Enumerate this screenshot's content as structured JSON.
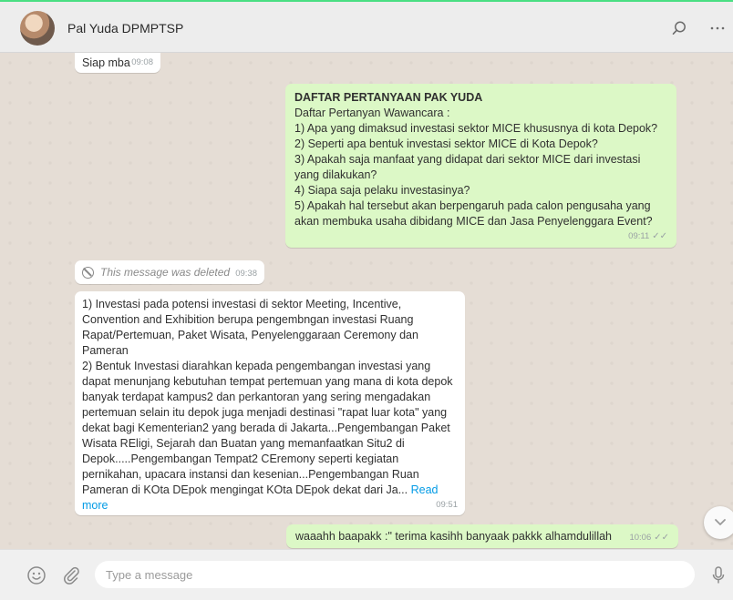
{
  "header": {
    "contact_name": "Pal Yuda DPMPTSP",
    "icons": [
      "avatar",
      "search-icon",
      "more-icon"
    ]
  },
  "messages": [
    {
      "direction": "incoming",
      "text": "Siap mba",
      "time": "09:08"
    },
    {
      "direction": "outgoing",
      "title": "DAFTAR PERTANYAAN PAK YUDA",
      "lines": [
        "Daftar Pertanyan Wawancara :",
        "1) Apa yang dimaksud investasi sektor MICE khususnya di kota Depok?",
        "2) Seperti apa bentuk investasi sektor MICE di Kota Depok?",
        "3) Apakah saja manfaat yang didapat dari sektor MICE dari investasi yang dilakukan?",
        "4) Siapa saja pelaku investasinya?",
        "5) Apakah hal tersebut akan berpengaruh pada calon pengusaha yang akan membuka usaha dibidang MICE dan Jasa Penyelenggara Event?"
      ],
      "time": "09:11",
      "status": "read"
    },
    {
      "direction": "incoming",
      "deleted_text": "This message was deleted",
      "time": "09:38"
    },
    {
      "direction": "incoming",
      "lines": [
        "1) Investasi pada potensi investasi di sektor Meeting, Incentive, Convention and Exhibition berupa pengembngan investasi Ruang Rapat/Pertemuan, Paket Wisata, Penyelenggaraan Ceremony dan Pameran",
        "2) Bentuk Investasi diarahkan kepada pengembangan investasi yang dapat menunjang kebutuhan tempat pertemuan yang mana di kota depok banyak terdapat kampus2 dan perkantoran yang sering mengadakan pertemuan selain itu depok juga menjadi destinasi \"rapat luar kota\" yang dekat bagi Kementerian2 yang berada di Jakarta...Pengembangan Paket Wisata REligi, Sejarah dan Buatan yang memanfaatkan Situ2 di Depok.....Pengembangan Tempat2 CEremony seperti kegiatan pernikahan, upacara instansi dan kesenian...Pengembangan Ruan Pameran di KOta DEpok mengingat KOta DEpok dekat dari Ja..."
      ],
      "read_more": "Read more",
      "time": "09:51"
    },
    {
      "direction": "outgoing",
      "text": "waaahh baapakk :\" terima kasihh banyaak pakkk alhamdulillah",
      "time": "10:06",
      "status": "read"
    }
  ],
  "composer": {
    "placeholder": "Type a message",
    "icons": [
      "emoji-icon",
      "attach-icon",
      "mic-icon"
    ]
  },
  "colors": {
    "accent": "#4adf83",
    "incoming_bubble": "#ffffff",
    "outgoing_bubble": "#dcf8c6",
    "chat_background": "#e5ddd5",
    "link": "#039be5"
  }
}
